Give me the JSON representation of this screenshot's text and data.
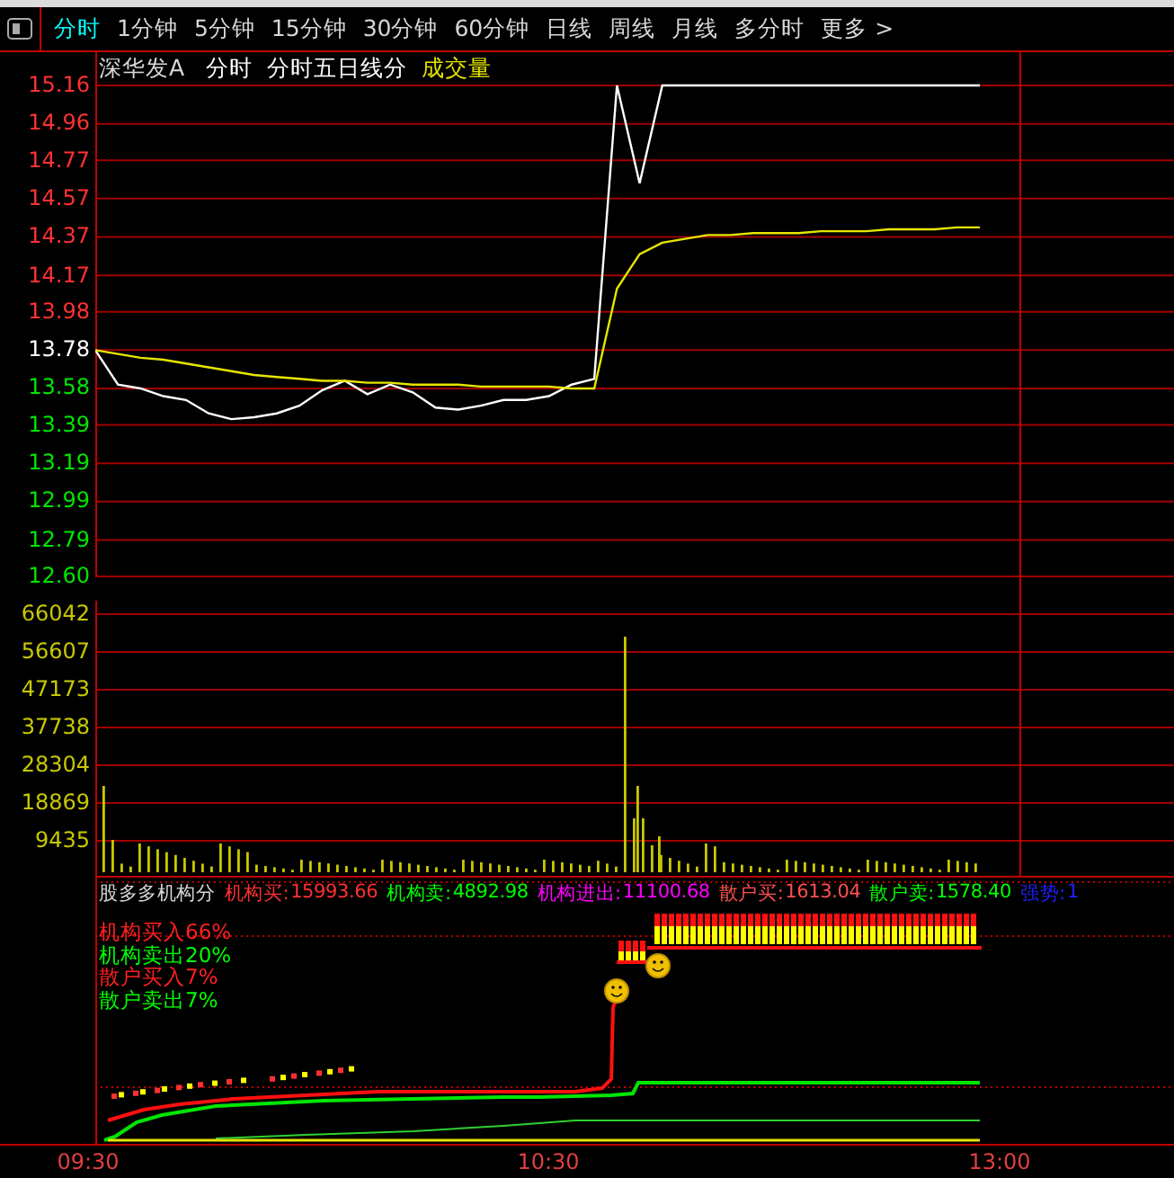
{
  "toolbar": {
    "tabs": [
      {
        "label": "分时",
        "selected": true
      },
      {
        "label": "1分钟",
        "selected": false
      },
      {
        "label": "5分钟",
        "selected": false
      },
      {
        "label": "15分钟",
        "selected": false
      },
      {
        "label": "30分钟",
        "selected": false
      },
      {
        "label": "60分钟",
        "selected": false
      },
      {
        "label": "日线",
        "selected": false
      },
      {
        "label": "周线",
        "selected": false
      },
      {
        "label": "月线",
        "selected": false
      },
      {
        "label": "多分时",
        "selected": false
      },
      {
        "label": "更多 >",
        "selected": false
      }
    ]
  },
  "header": {
    "stock": "深华发A",
    "items": [
      {
        "label": "分时",
        "kind": "plain"
      },
      {
        "label": "分时五日线分",
        "kind": "plain"
      },
      {
        "label": "成交量",
        "kind": "volume"
      }
    ]
  },
  "price_chart": {
    "tick_labels": [
      {
        "color": "#ff3232"
      },
      {
        "color": "#ff3232"
      },
      {
        "color": "#ff3232"
      },
      {
        "color": "#ff3232"
      },
      {
        "color": "#ff3232"
      },
      {
        "color": "#ff3232"
      },
      {
        "color": "#ff3232"
      },
      {
        "color": "#ffffff"
      },
      {
        "color": "#00e600"
      },
      {
        "color": "#00e600"
      },
      {
        "color": "#00e600"
      },
      {
        "color": "#00e600"
      },
      {
        "color": "#00e600"
      },
      {
        "color": "#00e600"
      }
    ],
    "chart_data": {
      "type": "line",
      "grid": true,
      "ylim": [
        12.6,
        15.16
      ],
      "yticks": [
        {
          "value": 15.16,
          "label": "15.16"
        },
        {
          "value": 14.96,
          "label": "14.96"
        },
        {
          "value": 14.77,
          "label": "14.77"
        },
        {
          "value": 14.57,
          "label": "14.57"
        },
        {
          "value": 14.37,
          "label": "14.37"
        },
        {
          "value": 14.17,
          "label": "14.17"
        },
        {
          "value": 13.98,
          "label": "13.98"
        },
        {
          "value": 13.78,
          "label": "13.78"
        },
        {
          "value": 13.58,
          "label": "13.58"
        },
        {
          "value": 13.39,
          "label": "13.39"
        },
        {
          "value": 13.19,
          "label": "13.19"
        },
        {
          "value": 12.99,
          "label": "12.99"
        },
        {
          "value": 12.79,
          "label": "12.79"
        },
        {
          "value": 12.6,
          "label": "12.60"
        }
      ],
      "categories": [
        null,
        null,
        null,
        null,
        null,
        null,
        null,
        null,
        null,
        null,
        null,
        null,
        null,
        null,
        null,
        null,
        null,
        null,
        null,
        null,
        null,
        null,
        null,
        null,
        null,
        null,
        null,
        null,
        null,
        null,
        null,
        null,
        null,
        null,
        null,
        null,
        null,
        null,
        null,
        null
      ],
      "series": [
        {
          "color": "#ffffff",
          "values": [
            13.78,
            13.6,
            13.58,
            13.54,
            13.52,
            13.45,
            13.42,
            13.43,
            13.45,
            13.49,
            13.57,
            13.62,
            13.55,
            13.6,
            13.56,
            13.48,
            13.47,
            13.49,
            13.52,
            13.52,
            13.54,
            13.6,
            13.63,
            15.16,
            14.65,
            15.16,
            15.16,
            15.16,
            15.16,
            15.16,
            15.16,
            15.16,
            15.16,
            15.16,
            15.16,
            15.16,
            15.16,
            15.16,
            15.16,
            15.16
          ]
        },
        {
          "color": "#e6e600",
          "values": [
            13.78,
            13.76,
            13.74,
            13.73,
            13.71,
            13.69,
            13.67,
            13.65,
            13.64,
            13.63,
            13.62,
            13.62,
            13.61,
            13.61,
            13.6,
            13.6,
            13.6,
            13.59,
            13.59,
            13.59,
            13.59,
            13.58,
            13.58,
            14.1,
            14.28,
            14.34,
            14.36,
            14.38,
            14.38,
            14.39,
            14.39,
            14.39,
            14.4,
            14.4,
            14.4,
            14.41,
            14.41,
            14.41,
            14.42,
            14.42
          ]
        }
      ]
    }
  },
  "volume_axis": [
    "66042",
    "56607",
    "47173",
    "37738",
    "28304",
    "18869",
    "9435"
  ],
  "indicator": {
    "title": "股多多机构分",
    "readings": [
      {
        "label": "机构买:",
        "value": "15993.66",
        "color": "#ff3030"
      },
      {
        "label": "机构卖:",
        "value": "4892.98",
        "color": "#00ff00"
      },
      {
        "label": "机构进出:",
        "value": "11100.68",
        "color": "#ff00ff"
      },
      {
        "label": "散户买:",
        "value": "1613.04",
        "color": "#ff5050"
      },
      {
        "label": "散户卖:",
        "value": "1578.40",
        "color": "#00ff00"
      },
      {
        "label": "强势:",
        "value": "1",
        "color": "#2020ff"
      }
    ],
    "legend": [
      {
        "label": "机构买入66%",
        "color": "#ff2020"
      },
      {
        "label": "机构卖出20%",
        "color": "#00ff00"
      },
      {
        "label": "散户买入7%",
        "color": "#ff2020"
      },
      {
        "label": "散户卖出7%",
        "color": "#00ff00"
      }
    ]
  },
  "time_axis": [
    "09:30",
    "10:30",
    "13:00"
  ]
}
